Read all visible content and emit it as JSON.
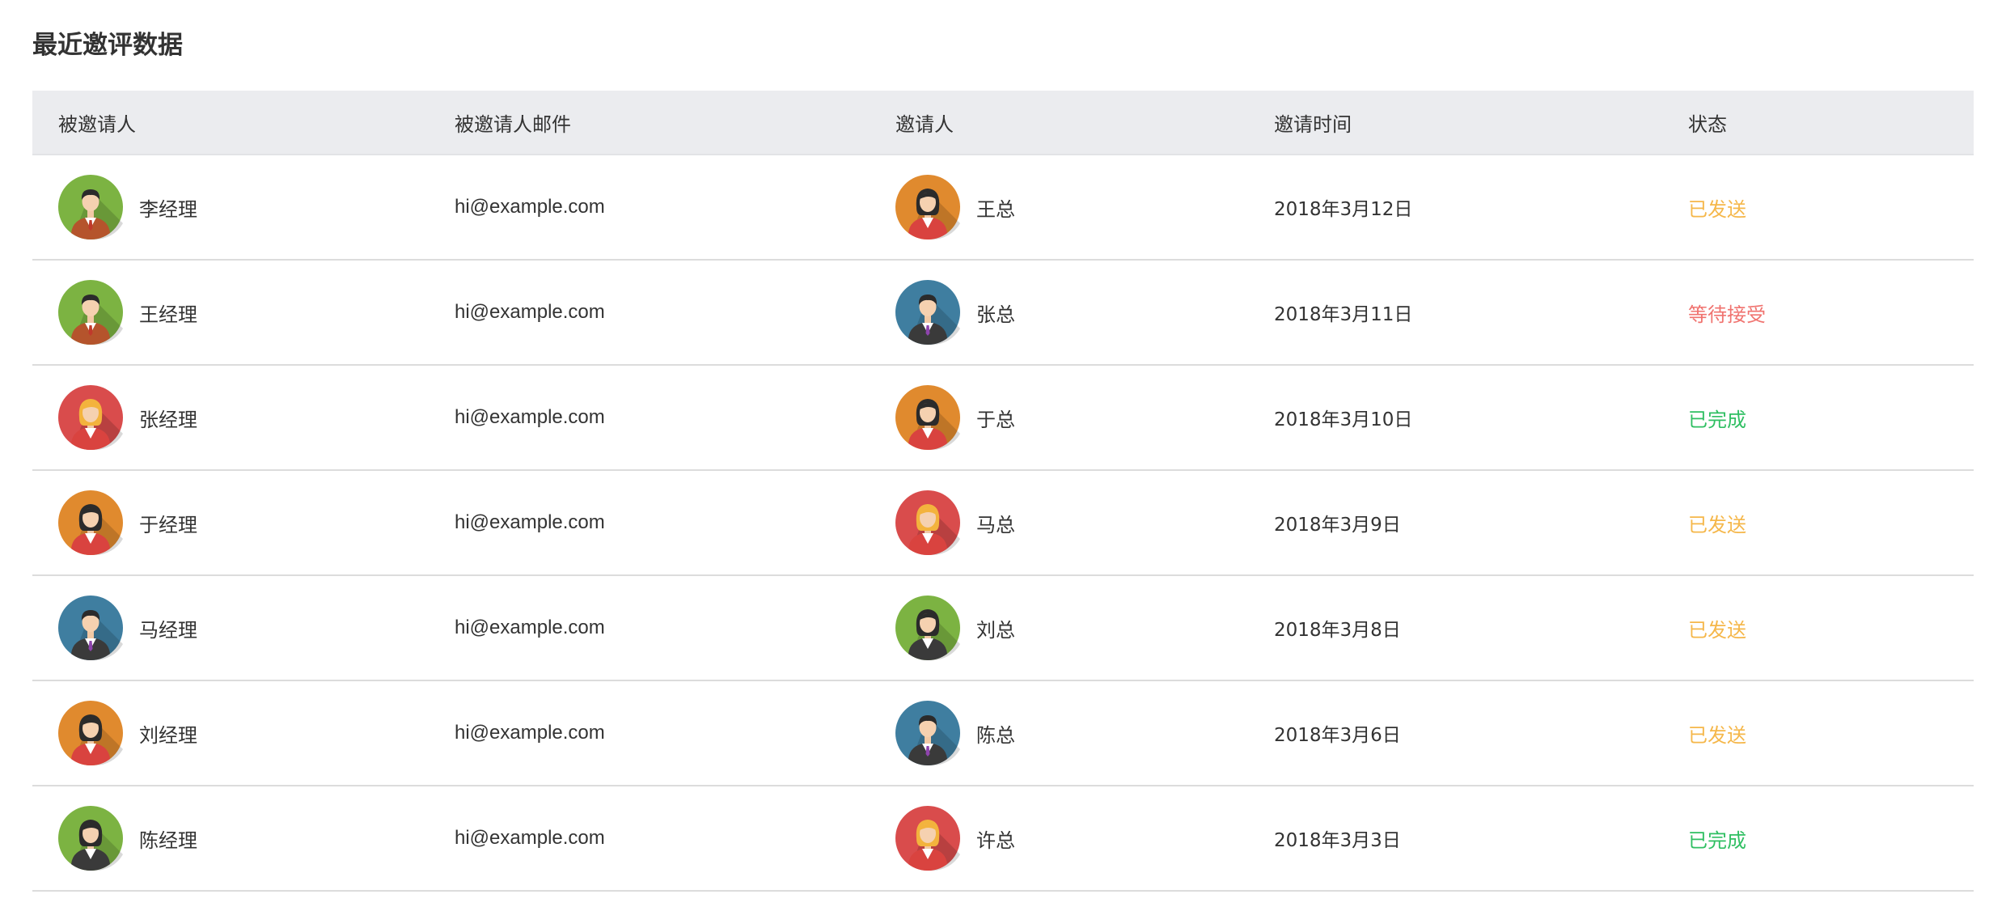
{
  "page": {
    "title": "最近邀评数据"
  },
  "table": {
    "headers": [
      "被邀请人",
      "被邀请人邮件",
      "邀请人",
      "邀请时间",
      "状态"
    ],
    "rows": [
      {
        "invitee": "李经理",
        "invitee_avatar": "man-green-avatar",
        "email": "hi@example.com",
        "inviter": "王总",
        "inviter_avatar": "woman-orange-avatar",
        "time": "2018年3月12日",
        "status": "已发送",
        "status_type": "sent"
      },
      {
        "invitee": "王经理",
        "invitee_avatar": "man-green-avatar",
        "email": "hi@example.com",
        "inviter": "张总",
        "inviter_avatar": "man-blue-avatar",
        "time": "2018年3月11日",
        "status": "等待接受",
        "status_type": "waiting"
      },
      {
        "invitee": "张经理",
        "invitee_avatar": "woman-blonde-red-avatar",
        "email": "hi@example.com",
        "inviter": "于总",
        "inviter_avatar": "woman-orange-avatar",
        "time": "2018年3月10日",
        "status": "已完成",
        "status_type": "done"
      },
      {
        "invitee": "于经理",
        "invitee_avatar": "woman-orange-avatar",
        "email": "hi@example.com",
        "inviter": "马总",
        "inviter_avatar": "woman-blonde-red-avatar",
        "time": "2018年3月9日",
        "status": "已发送",
        "status_type": "sent"
      },
      {
        "invitee": "马经理",
        "invitee_avatar": "man-blue-avatar",
        "email": "hi@example.com",
        "inviter": "刘总",
        "inviter_avatar": "woman-green-avatar",
        "time": "2018年3月8日",
        "status": "已发送",
        "status_type": "sent"
      },
      {
        "invitee": "刘经理",
        "invitee_avatar": "woman-orange-avatar",
        "email": "hi@example.com",
        "inviter": "陈总",
        "inviter_avatar": "man-blue-avatar",
        "time": "2018年3月6日",
        "status": "已发送",
        "status_type": "sent"
      },
      {
        "invitee": "陈经理",
        "invitee_avatar": "woman-green-avatar",
        "email": "hi@example.com",
        "inviter": "许总",
        "inviter_avatar": "woman-blonde-red-avatar",
        "time": "2018年3月3日",
        "status": "已完成",
        "status_type": "done"
      }
    ]
  },
  "colors": {
    "header_bg": "#ebecef",
    "status_sent": "#f5b74a",
    "status_waiting": "#f0736f",
    "status_done": "#2fbf62",
    "avatar_green": "#7cb342",
    "avatar_orange": "#e08a2e",
    "avatar_red": "#d94c4c",
    "avatar_blue": "#3f7ea0"
  }
}
